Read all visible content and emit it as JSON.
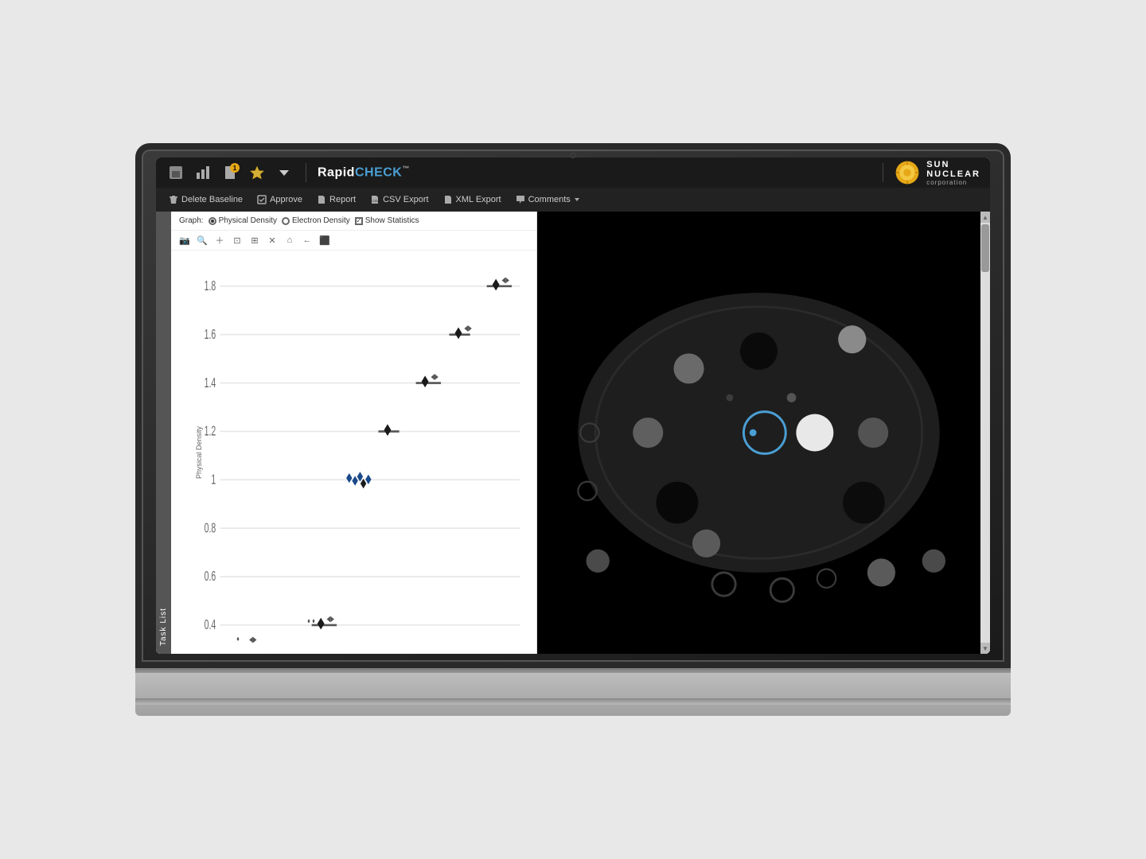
{
  "app": {
    "title": "RapidCHECK",
    "title_trademark": "™",
    "logo": {
      "sun": "SUN",
      "nuclear": "NUCLEAR",
      "corporation": "corporation"
    }
  },
  "nav": {
    "icons": [
      "home-icon",
      "chart-icon",
      "file-icon",
      "star-icon",
      "dropdown-icon"
    ],
    "badge": "1"
  },
  "actions": [
    {
      "icon": "trash-icon",
      "label": "Delete Baseline"
    },
    {
      "icon": "approve-icon",
      "label": "Approve"
    },
    {
      "icon": "report-icon",
      "label": "Report"
    },
    {
      "icon": "csv-icon",
      "label": "CSV Export"
    },
    {
      "icon": "xml-icon",
      "label": "XML Export"
    },
    {
      "icon": "comments-icon",
      "label": "Comments"
    }
  ],
  "sidebar": {
    "task_list_label": "Task List"
  },
  "graph": {
    "title": "Graph:",
    "options": [
      {
        "label": "Physical Density",
        "type": "radio",
        "selected": true
      },
      {
        "label": "Electron Density",
        "type": "radio",
        "selected": false
      },
      {
        "label": "Show Statistics",
        "type": "checkbox",
        "checked": true
      }
    ],
    "y_axis_label": "Physical Density",
    "y_values": [
      "1.8",
      "1.6",
      "1.4",
      "1.2",
      "1",
      "0.8",
      "0.6",
      "0.4"
    ],
    "data_points": [
      {
        "x": 55,
        "y": 12,
        "value": 1.8
      },
      {
        "x": 47,
        "y": 18,
        "value": 1.6
      },
      {
        "x": 39,
        "y": 26,
        "value": 1.4
      },
      {
        "x": 33,
        "y": 34,
        "value": 1.2
      },
      {
        "x": 28,
        "y": 46,
        "value": 1.0
      },
      {
        "x": 22,
        "y": 72,
        "value": 0.4
      }
    ]
  },
  "phantom": {
    "description": "CT phantom scan image showing circular phantom with various density inserts"
  },
  "colors": {
    "top_bar": "#1a1a1a",
    "action_bar": "#222222",
    "accent_blue": "#4a9fd4",
    "badge_color": "#e6a817",
    "phantom_bg": "#000000",
    "phantom_outer": "#2a2a2a",
    "phantom_ring": "#3a3a3a"
  }
}
